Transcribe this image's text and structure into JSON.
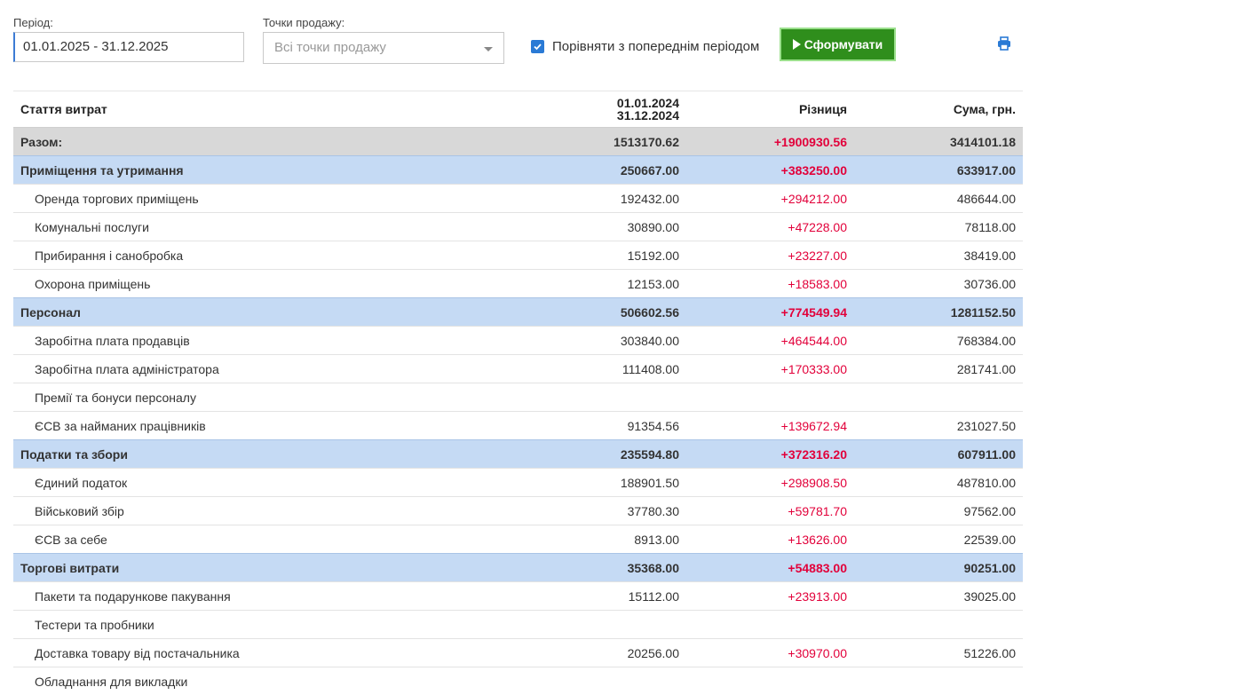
{
  "filters": {
    "period_label": "Період:",
    "period_value": "01.01.2025 - 31.12.2025",
    "shops_label": "Точки продажу:",
    "shops_placeholder": "Всі точки продажу",
    "compare_label": "Порівняти з попереднім періодом",
    "compare_checked": true,
    "build_button": "Сформувати"
  },
  "colors": {
    "accent": "#2a7ad5",
    "button": "#2f8e1c",
    "diff_positive": "#e2003a",
    "category_row": "#c5daf4",
    "total_row": "#d8d8d8"
  },
  "icons": {
    "print": "print-icon",
    "build": "play-icon",
    "dropdown": "chevron-down-icon"
  },
  "table": {
    "headers": {
      "name": "Стаття витрат",
      "prev_from": "01.01.2024",
      "prev_to": "31.12.2024",
      "diff": "Різниця",
      "sum": "Сума, грн."
    },
    "rows": [
      {
        "type": "total",
        "name": "Разом:",
        "prev": "1513170.62",
        "diff": "+1900930.56",
        "sum": "3414101.18"
      },
      {
        "type": "cat",
        "name": "Приміщення та утримання",
        "prev": "250667.00",
        "diff": "+383250.00",
        "sum": "633917.00"
      },
      {
        "type": "item",
        "name": "Оренда торгових приміщень",
        "prev": "192432.00",
        "diff": "+294212.00",
        "sum": "486644.00"
      },
      {
        "type": "item",
        "name": "Комунальні послуги",
        "prev": "30890.00",
        "diff": "+47228.00",
        "sum": "78118.00"
      },
      {
        "type": "item",
        "name": "Прибирання і санобробка",
        "prev": "15192.00",
        "diff": "+23227.00",
        "sum": "38419.00"
      },
      {
        "type": "item",
        "name": "Охорона приміщень",
        "prev": "12153.00",
        "diff": "+18583.00",
        "sum": "30736.00"
      },
      {
        "type": "cat",
        "name": "Персонал",
        "prev": "506602.56",
        "diff": "+774549.94",
        "sum": "1281152.50"
      },
      {
        "type": "item",
        "name": "Заробітна плата продавців",
        "prev": "303840.00",
        "diff": "+464544.00",
        "sum": "768384.00"
      },
      {
        "type": "item",
        "name": "Заробітна плата адміністратора",
        "prev": "111408.00",
        "diff": "+170333.00",
        "sum": "281741.00"
      },
      {
        "type": "item",
        "name": "Премії та бонуси персоналу",
        "prev": "",
        "diff": "",
        "sum": ""
      },
      {
        "type": "item",
        "name": "ЄСВ за найманих працівників",
        "prev": "91354.56",
        "diff": "+139672.94",
        "sum": "231027.50"
      },
      {
        "type": "cat",
        "name": "Податки та збори",
        "prev": "235594.80",
        "diff": "+372316.20",
        "sum": "607911.00"
      },
      {
        "type": "item",
        "name": "Єдиний податок",
        "prev": "188901.50",
        "diff": "+298908.50",
        "sum": "487810.00"
      },
      {
        "type": "item",
        "name": "Військовий збір",
        "prev": "37780.30",
        "diff": "+59781.70",
        "sum": "97562.00"
      },
      {
        "type": "item",
        "name": "ЄСВ за себе",
        "prev": "8913.00",
        "diff": "+13626.00",
        "sum": "22539.00"
      },
      {
        "type": "cat",
        "name": "Торгові витрати",
        "prev": "35368.00",
        "diff": "+54883.00",
        "sum": "90251.00"
      },
      {
        "type": "item",
        "name": "Пакети та подарункове пакування",
        "prev": "15112.00",
        "diff": "+23913.00",
        "sum": "39025.00"
      },
      {
        "type": "item",
        "name": "Тестери та пробники",
        "prev": "",
        "diff": "",
        "sum": ""
      },
      {
        "type": "item",
        "name": "Доставка товару від постачальника",
        "prev": "20256.00",
        "diff": "+30970.00",
        "sum": "51226.00"
      },
      {
        "type": "item",
        "name": "Обладнання для викладки",
        "prev": "",
        "diff": "",
        "sum": ""
      }
    ]
  }
}
